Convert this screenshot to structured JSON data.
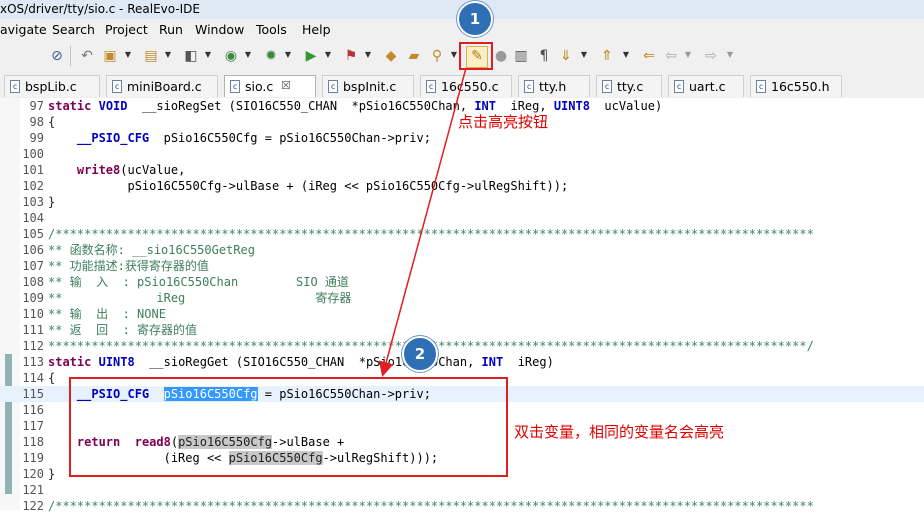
{
  "window": {
    "title": "xOS/driver/tty/sio.c - RealEvo-IDE"
  },
  "menu": [
    "avigate",
    "Search",
    "Project",
    "Run",
    "Window",
    "Tools",
    "Help"
  ],
  "tabs": [
    {
      "label": "bspLib.c",
      "active": false
    },
    {
      "label": "miniBoard.c",
      "active": false
    },
    {
      "label": "sio.c",
      "active": true,
      "close": "☒"
    },
    {
      "label": "bspInit.c",
      "active": false
    },
    {
      "label": "16c550.c",
      "active": false
    },
    {
      "label": "tty.h",
      "active": false
    },
    {
      "label": "tty.c",
      "active": false
    },
    {
      "label": "uart.c",
      "active": false
    },
    {
      "label": "16c550.h",
      "active": false
    }
  ],
  "file_icon_letter": "c",
  "annotations": {
    "badge1": "1",
    "badge2": "2",
    "text1": "点击高亮按钮",
    "text2": "双击变量，相同的变量名会高亮"
  },
  "code": {
    "l97": {
      "n": "97",
      "a": "static",
      "b": "VOID",
      "c": "__sioRegSet",
      "d": "(SIO16C550_CHAN",
      "e": "*pSio16C550Chan,",
      "f": "INT",
      "g": "iReg,",
      "h": "UINT8",
      "i": "ucValue)"
    },
    "l98": {
      "n": "98",
      "t": "{"
    },
    "l99": {
      "n": "99",
      "a": "__PSIO_CFG",
      "b": "pSio16C550Cfg = pSio16C550Chan->priv;"
    },
    "l100": {
      "n": "100"
    },
    "l101": {
      "n": "101",
      "a": "write8",
      "b": "(ucValue,"
    },
    "l102": {
      "n": "102",
      "t": "pSio16C550Cfg->ulBase + (iReg << pSio16C550Cfg->ulRegShift));"
    },
    "l103": {
      "n": "103",
      "t": "}"
    },
    "l104": {
      "n": "104"
    },
    "l105": {
      "n": "105",
      "t": "/*********************************************************************************************************"
    },
    "l106": {
      "n": "106",
      "a": "** 函数名称:",
      "b": "__sio16C550GetReg"
    },
    "l107": {
      "n": "107",
      "a": "** 功能描述:",
      "b": "获得寄存器的值"
    },
    "l108": {
      "n": "108",
      "a": "** 输  入  :",
      "b": "pSio16C550Chan",
      "c": "SIO 通道"
    },
    "l109": {
      "n": "109",
      "a": "**",
      "b": "iReg",
      "c": "寄存器"
    },
    "l110": {
      "n": "110",
      "a": "** 输  出  :",
      "b": "NONE"
    },
    "l111": {
      "n": "111",
      "a": "** 返  回  :",
      "b": "寄存器的值"
    },
    "l112": {
      "n": "112",
      "t": "*********************************************************************************************************/"
    },
    "l113": {
      "n": "113",
      "a": "static",
      "b": "UINT8",
      "c": "__sioRegGet",
      "d": "(SIO16C550_CHAN",
      "e": "*pSio16C550Chan,",
      "f": "INT",
      "g": "iReg)"
    },
    "l114": {
      "n": "114",
      "t": "{"
    },
    "l115": {
      "n": "115",
      "a": "__PSIO_CFG",
      "b": "pSio16C550Cfg",
      "c": "= pSio16C550Chan->priv;"
    },
    "l116": {
      "n": "116"
    },
    "l117": {
      "n": "117"
    },
    "l118": {
      "n": "118",
      "a": "return",
      "b": "read8",
      "c": "(",
      "d": "pSio16C550Cfg",
      "e": "->ulBase +"
    },
    "l119": {
      "n": "119",
      "a": "(iReg <<",
      "b": "pSio16C550Cfg",
      "c": "->ulRegShift)));"
    },
    "l120": {
      "n": "120",
      "t": "}"
    },
    "l121": {
      "n": "121"
    },
    "l122": {
      "n": "122",
      "t": "/*********************************************************************************************************"
    }
  }
}
